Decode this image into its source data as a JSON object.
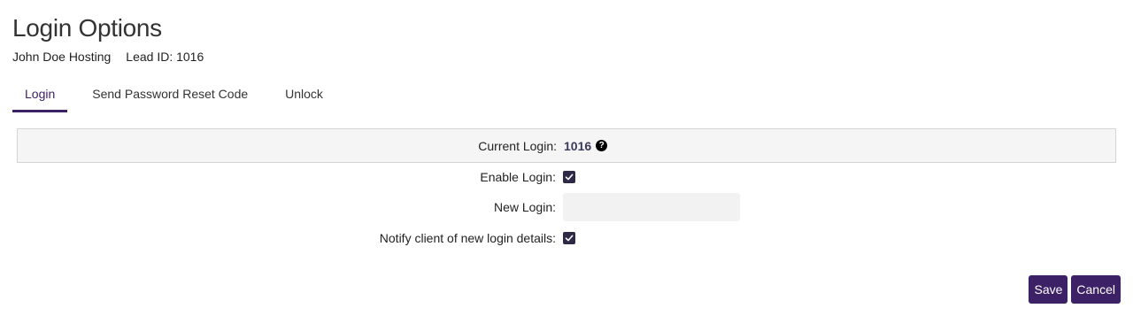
{
  "header": {
    "title": "Login Options",
    "client_name": "John Doe Hosting",
    "lead_id": "Lead ID: 1016"
  },
  "tabs": [
    {
      "label": "Login",
      "active": true
    },
    {
      "label": "Send Password Reset Code",
      "active": false
    },
    {
      "label": "Unlock",
      "active": false
    }
  ],
  "form": {
    "current_login_label": "Current Login:",
    "current_login_value": "1016",
    "enable_login_label": "Enable Login:",
    "enable_login_checked": true,
    "new_login_label": "New Login:",
    "new_login_value": "",
    "notify_label": "Notify client of new login details:",
    "notify_checked": true
  },
  "actions": {
    "save_label": "Save",
    "cancel_label": "Cancel"
  },
  "colors": {
    "accent": "#3d2166",
    "checkbox": "#2e2a45"
  },
  "icons": {
    "help": "help-icon",
    "check": "checkmark-icon"
  }
}
